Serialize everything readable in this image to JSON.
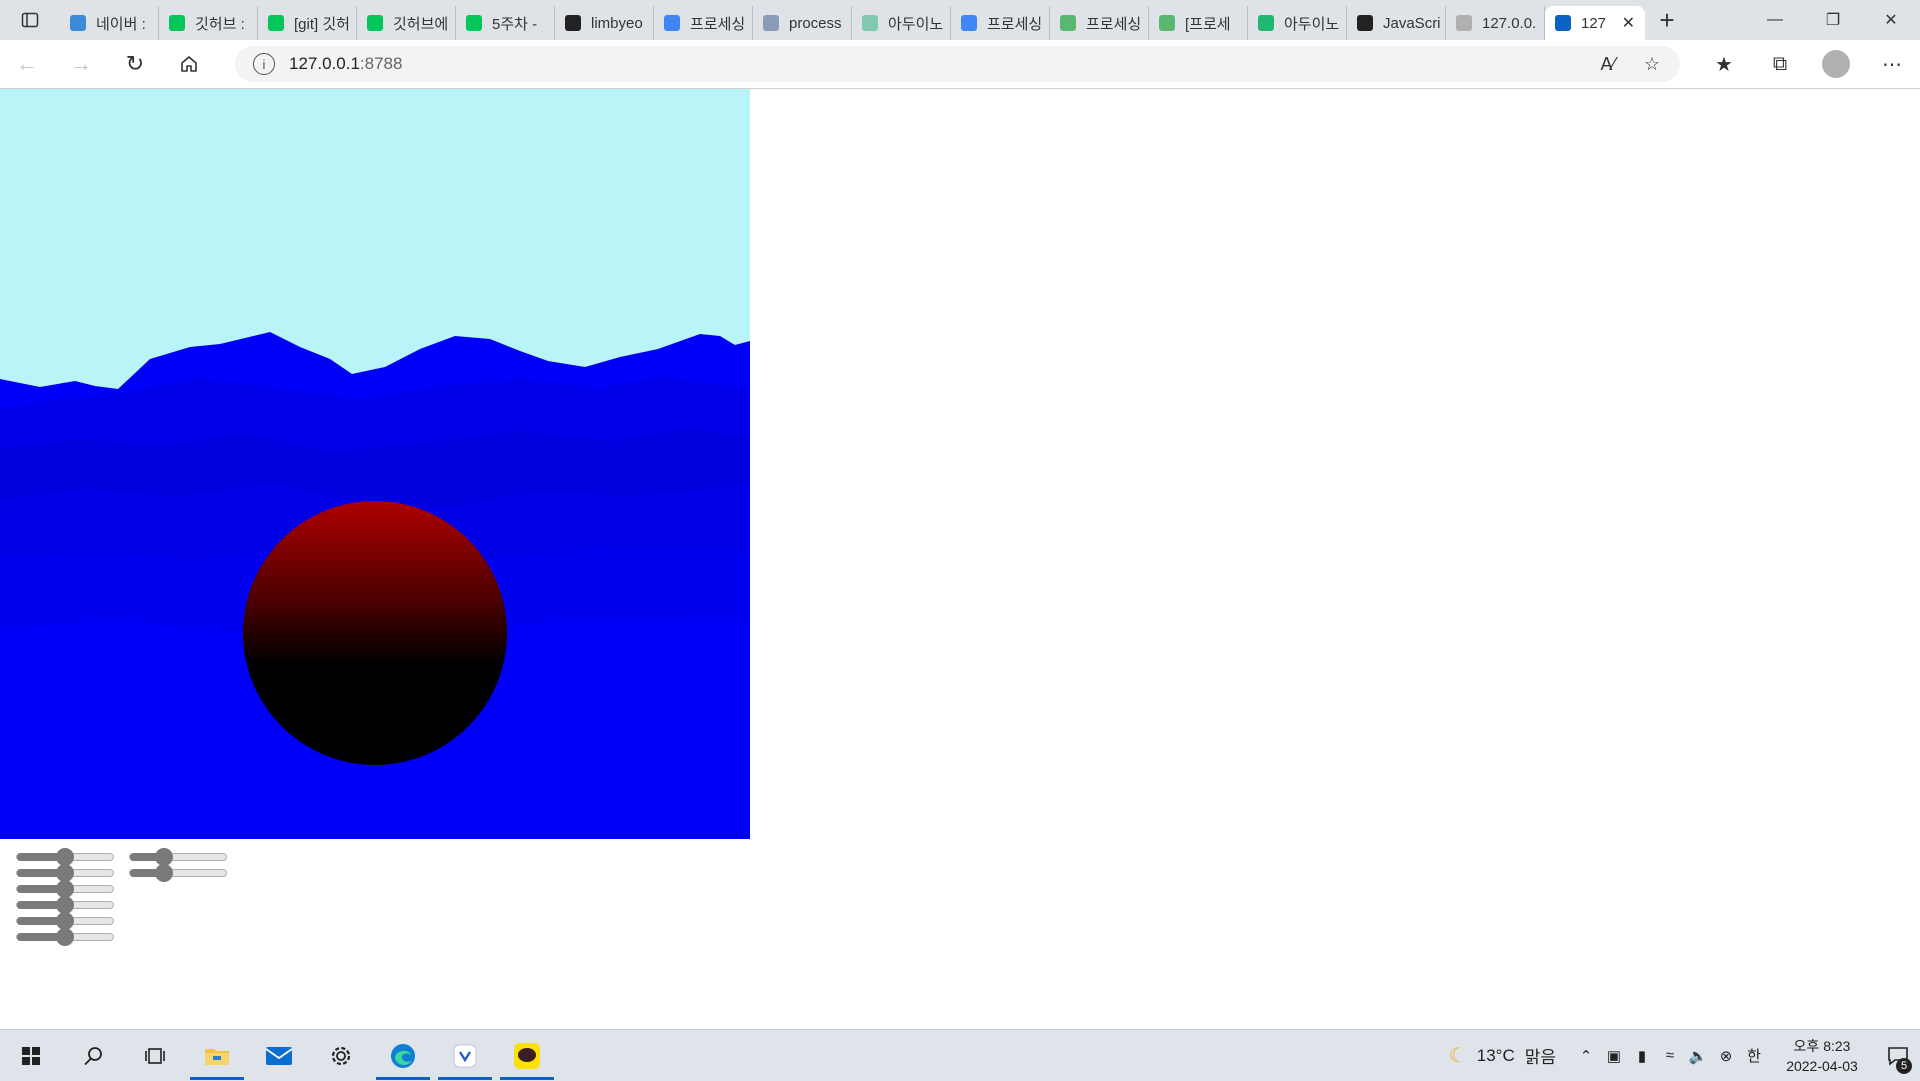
{
  "browser": {
    "tabs": [
      {
        "label": "네이버 :",
        "icon": "bing-icon",
        "color": "#3b8bd9"
      },
      {
        "label": "깃허브 :",
        "icon": "naver-icon",
        "color": "#03c75a"
      },
      {
        "label": "[git] 깃허",
        "icon": "naver-blog-icon",
        "color": "#03c75a"
      },
      {
        "label": "깃허브에",
        "icon": "naver-blog-icon",
        "color": "#03c75a"
      },
      {
        "label": "5주차 -",
        "icon": "naver-blog-icon",
        "color": "#03c75a"
      },
      {
        "label": "limbyeo",
        "icon": "github-icon",
        "color": "#222222"
      },
      {
        "label": "프로세싱",
        "icon": "google-icon",
        "color": "#4285f4"
      },
      {
        "label": "process",
        "icon": "wikipedia-icon",
        "color": "#8a9bb8"
      },
      {
        "label": "아두이노",
        "icon": "site-icon",
        "color": "#80c8b0"
      },
      {
        "label": "프로세싱",
        "icon": "google-icon",
        "color": "#4285f4"
      },
      {
        "label": "프로세싱",
        "icon": "doc-icon",
        "color": "#58b870"
      },
      {
        "label": "[프로세",
        "icon": "doc-icon",
        "color": "#58b870"
      },
      {
        "label": "아두이노",
        "icon": "site-icon",
        "color": "#20b870"
      },
      {
        "label": "JavaScri",
        "icon": "js-icon",
        "color": "#222222"
      },
      {
        "label": "127.0.0.",
        "icon": "page-icon",
        "color": "#b0b0b0"
      },
      {
        "label": "127",
        "icon": "page-icon",
        "color": "#0a64c8",
        "active": true
      }
    ],
    "address": {
      "host": "127.0.0.1",
      "port": ":8788"
    }
  },
  "scene": {
    "sky_color": "#b8f4f8",
    "ground_color": "#0000ff",
    "sphere_color": "#b00000"
  },
  "controls": {
    "slider_group_1": [
      0.5,
      0.5,
      0.5,
      0.5,
      0.5,
      0.5
    ],
    "slider_group_2": [
      0.35,
      0.35
    ]
  },
  "taskbar": {
    "weather": {
      "temp": "13°C",
      "condition": "맑음"
    },
    "ime": "한",
    "clock": {
      "time": "오후 8:23",
      "date": "2022-04-03"
    },
    "notifications": "5"
  }
}
